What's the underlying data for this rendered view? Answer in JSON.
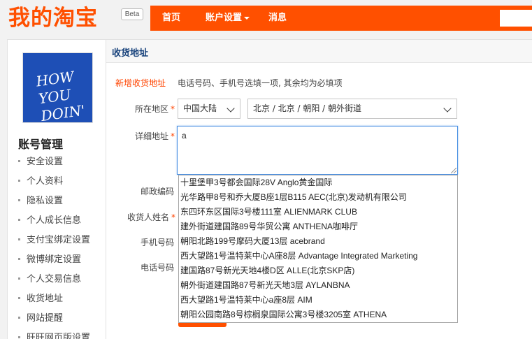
{
  "header": {
    "logo": "我的淘宝",
    "beta": "Beta",
    "nav": {
      "home": "首页",
      "account": "账户设置",
      "messages": "消息"
    }
  },
  "sidebar": {
    "avatar_lines": [
      "HOW",
      "YOU",
      "DOIN'"
    ],
    "title": "账号管理",
    "items": [
      {
        "label": "安全设置"
      },
      {
        "label": "个人资料"
      },
      {
        "label": "隐私设置"
      },
      {
        "label": "个人成长信息"
      },
      {
        "label": "支付宝绑定设置"
      },
      {
        "label": "微博绑定设置"
      },
      {
        "label": "个人交易信息"
      },
      {
        "label": "收货地址"
      },
      {
        "label": "网站提醒"
      },
      {
        "label": "旺旺网页版设置"
      }
    ]
  },
  "main": {
    "title": "收货地址",
    "new_address_tab": "新增收货地址",
    "hint": "电话号码、手机号选填一项, 其余均为必填项",
    "labels": {
      "region": "所在地区",
      "detail": "详细地址",
      "zip": "邮政编码",
      "name": "收货人姓名",
      "mobile": "手机号码",
      "phone": "电话号码"
    },
    "required_mark": "*",
    "country_select": "中国大陆",
    "area_select": "北京 / 北京 / 朝阳 / 朝外街道",
    "detail_value": "a"
  },
  "suggestions": [
    "十里堡甲3号都会国际28V Anglo黄金国际",
    "光华路甲8号和乔大厦B座1层B115 AEC(北京)发动机有限公司",
    "东四环东区国际3号楼111室 ALIENMARK CLUB",
    "建外街道建国路89号华贸公寓 ANTHENA咖啡厅",
    "朝阳北路199号摩码大厦13层 acebrand",
    "西大望路1号温特莱中心A座8层 Advantage Integrated Marketing",
    "建国路87号新光天地4楼D区 ALLE(北京SKP店)",
    "朝外街道建国路87号新光天地3层 AYLANBNA",
    "西大望路1号温特莱中心a座8层 AIM",
    "朝阳公园南路8号棕榈泉国际公寓3号楼3205室 ATHENA"
  ],
  "colors": {
    "brand": "#ff5000",
    "link": "#15407a",
    "required": "#ff4400"
  }
}
